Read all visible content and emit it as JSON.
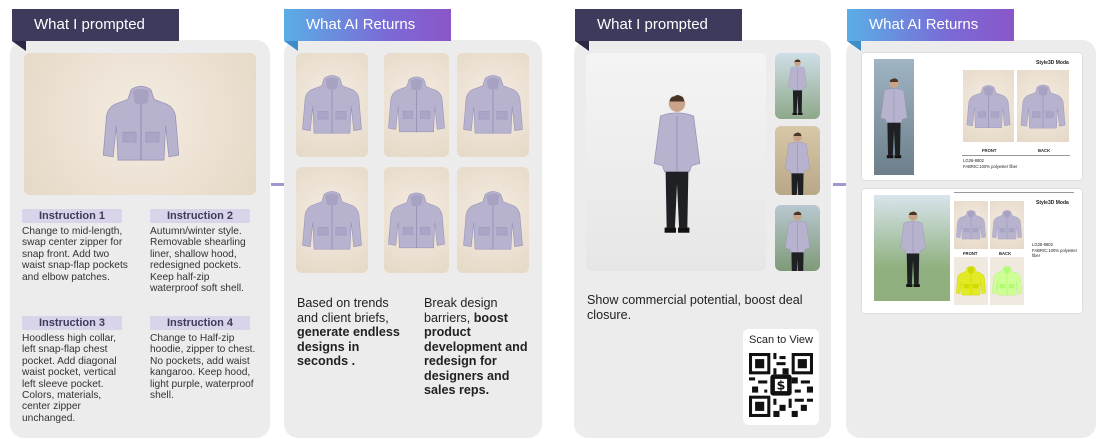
{
  "panels": {
    "p1": {
      "tab": "What I prompted"
    },
    "p2": {
      "tab": "What AI Returns"
    },
    "p3": {
      "tab": "What I prompted"
    },
    "p4": {
      "tab": "What AI Returns"
    }
  },
  "instructions": [
    {
      "label": "Instruction 1",
      "text": "Change to mid-length, swap center zipper for snap front. Add two waist snap-flap pockets and elbow patches."
    },
    {
      "label": "Instruction 2",
      "text": "Autumn/winter style. Removable shearling liner, shallow hood, redesigned pockets. Keep half-zip waterproof soft shell."
    },
    {
      "label": "Instruction 3",
      "text": "Hoodless high collar, left snap-flap chest pocket. Add diagonal waist pocket, vertical left sleeve pocket. Colors, materials, center zipper unchanged."
    },
    {
      "label": "Instruction 4",
      "text": "Change to Half-zip hoodie, zipper to chest. No pockets, add waist kangaroo. Keep hood, light purple, waterproof shell."
    }
  ],
  "returns_text": {
    "left_plain": "Based on trends and client briefs, ",
    "left_bold": "generate endless designs in seconds .",
    "right_plain": "Break design barriers, ",
    "right_bold": "boost product development and redesign for designers and sales reps."
  },
  "commercial": {
    "text": "Show commercial potential, boost deal closure.",
    "scan_label": "Scan to View"
  },
  "sheets": {
    "brand": "Style3D Moda",
    "front": "FRONT",
    "back": "BACK",
    "code1": "LG26-8802",
    "fabric1": "FABRIC:100% polyester fiber",
    "code2": "LG26-8802",
    "fabric2": "FABRIC:100% polyester fiber"
  },
  "colors": {
    "tab_dark": "#3d3a5c",
    "instr_bg": "#d9d4ea",
    "arrow": "#9d98cf",
    "jacket": "#b7b3cf"
  }
}
